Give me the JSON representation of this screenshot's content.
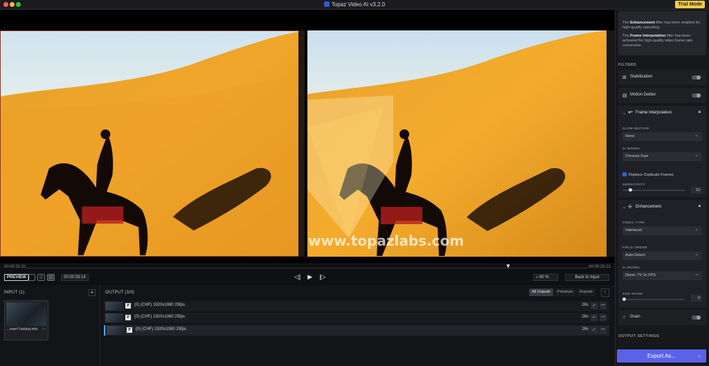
{
  "window": {
    "title": "Topaz Video AI  v3.2.0",
    "trial_badge": "Trial Mode"
  },
  "preview": {
    "watermark": "www.topazlabs.com"
  },
  "timeline": {
    "start_time": "00:00:31:31",
    "end_time": "00:00:33:21"
  },
  "toolbar": {
    "preview_label": "PREVIEW",
    "timecode": "00:00:33:14",
    "zoom": "80 %",
    "back_to_input": "Back to Input"
  },
  "input_panel": {
    "title": "INPUT (1)",
    "add_label": "+",
    "file_name": "...esert Fantasy.mkv",
    "menu": "..."
  },
  "output_panel": {
    "title": "OUTPUT (3/3)",
    "tabs": [
      "All Outputs",
      "Previews",
      "Exports"
    ],
    "rows": [
      {
        "p": "P",
        "info": "(0)   (CHF)   1920x1080   25fps",
        "duration": "26s"
      },
      {
        "p": "P",
        "info": "(0)   (CHF)   1920x1080   25fps",
        "duration": "26s"
      },
      {
        "p": "P",
        "info": "(0)   (CHF)   1920x1080   25fps",
        "duration": "26s"
      }
    ]
  },
  "sidebar": {
    "info_enhancement_pre": "The ",
    "info_enhancement_bold": "Enhancement",
    "info_enhancement_post": " filter has been enabled for high-quality upscaling.",
    "info_interp_pre": "The ",
    "info_interp_bold": "Frame Interpolation",
    "info_interp_post": " filter has been activated for high-quality video frame rate conversion.",
    "filters_title": "FILTERS",
    "stabilization": "Stabilization",
    "motion_deblur": "Motion Deblur",
    "frame_interpolation": {
      "title": "Frame Interpolation",
      "slow_motion_label": "SLOW MOTION",
      "slow_motion_value": "None",
      "ai_model_label": "AI MODEL",
      "ai_model_value": "Chronos Fast",
      "replace_duplicates": "Replace Duplicate Frames",
      "sensitivity_label": "SENSITIVITY",
      "sensitivity_value": "10",
      "sensitivity_fraction": 0.1
    },
    "enhancement": {
      "title": "Enhancement",
      "video_type_label": "VIDEO TYPE",
      "video_type_value": "Interlaced",
      "field_order_label": "FIELD ORDER",
      "field_order_value": "Auto-Detect",
      "ai_model_label": "AI MODEL",
      "ai_model_value": "Dione: TV 2x FPS",
      "add_noise_label": "ADD NOISE",
      "add_noise_value": "0",
      "add_noise_fraction": 0.0
    },
    "grain": "Grain",
    "output_settings_title": "OUTPUT SETTINGS",
    "export_label": "Export As..."
  }
}
